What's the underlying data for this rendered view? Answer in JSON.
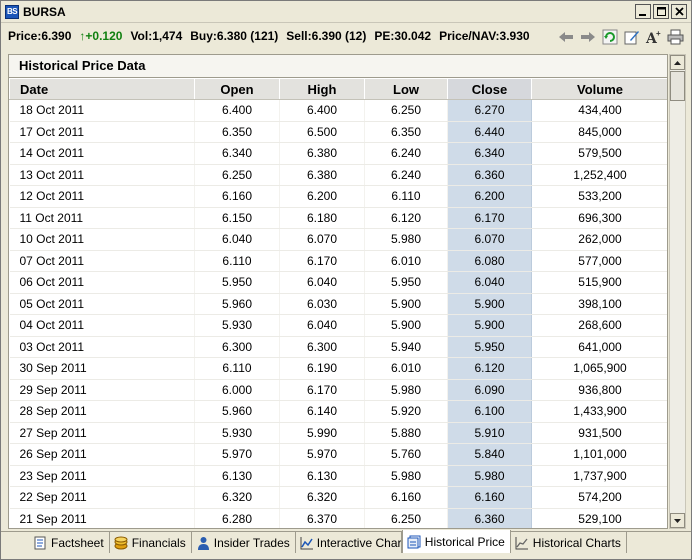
{
  "window": {
    "title": "BURSA",
    "app_icon": "BS"
  },
  "quote": {
    "price": "Price:6.390",
    "change": "+0.120",
    "vol": "Vol:1,474",
    "buy": "Buy:6.380 (121)",
    "sell": "Sell:6.390 (12)",
    "pe": "PE:30.042",
    "pnav": "Price/NAV:3.930"
  },
  "toolbar": {
    "icons": [
      "back-arrow-icon",
      "forward-arrow-icon",
      "refresh-icon",
      "edit-icon",
      "font-size-icon",
      "print-icon"
    ]
  },
  "panel": {
    "title": "Historical Price Data"
  },
  "table": {
    "headers": [
      "Date",
      "Open",
      "High",
      "Low",
      "Close",
      "Volume"
    ],
    "rows": [
      [
        "18 Oct 2011",
        "6.400",
        "6.400",
        "6.250",
        "6.270",
        "434,400"
      ],
      [
        "17 Oct 2011",
        "6.350",
        "6.500",
        "6.350",
        "6.440",
        "845,000"
      ],
      [
        "14 Oct 2011",
        "6.340",
        "6.380",
        "6.240",
        "6.340",
        "579,500"
      ],
      [
        "13 Oct 2011",
        "6.250",
        "6.380",
        "6.240",
        "6.360",
        "1,252,400"
      ],
      [
        "12 Oct 2011",
        "6.160",
        "6.200",
        "6.110",
        "6.200",
        "533,200"
      ],
      [
        "11 Oct 2011",
        "6.150",
        "6.180",
        "6.120",
        "6.170",
        "696,300"
      ],
      [
        "10 Oct 2011",
        "6.040",
        "6.070",
        "5.980",
        "6.070",
        "262,000"
      ],
      [
        "07 Oct 2011",
        "6.110",
        "6.170",
        "6.010",
        "6.080",
        "577,000"
      ],
      [
        "06 Oct 2011",
        "5.950",
        "6.040",
        "5.950",
        "6.040",
        "515,900"
      ],
      [
        "05 Oct 2011",
        "5.960",
        "6.030",
        "5.900",
        "5.900",
        "398,100"
      ],
      [
        "04 Oct 2011",
        "5.930",
        "6.040",
        "5.900",
        "5.900",
        "268,600"
      ],
      [
        "03 Oct 2011",
        "6.300",
        "6.300",
        "5.940",
        "5.950",
        "641,000"
      ],
      [
        "30 Sep 2011",
        "6.110",
        "6.190",
        "6.010",
        "6.120",
        "1,065,900"
      ],
      [
        "29 Sep 2011",
        "6.000",
        "6.170",
        "5.980",
        "6.090",
        "936,800"
      ],
      [
        "28 Sep 2011",
        "5.960",
        "6.140",
        "5.920",
        "6.100",
        "1,433,900"
      ],
      [
        "27 Sep 2011",
        "5.930",
        "5.990",
        "5.880",
        "5.910",
        "931,500"
      ],
      [
        "26 Sep 2011",
        "5.970",
        "5.970",
        "5.760",
        "5.840",
        "1,101,000"
      ],
      [
        "23 Sep 2011",
        "6.130",
        "6.130",
        "5.980",
        "5.980",
        "1,737,900"
      ],
      [
        "22 Sep 2011",
        "6.320",
        "6.320",
        "6.160",
        "6.160",
        "574,200"
      ],
      [
        "21 Sep 2011",
        "6.280",
        "6.370",
        "6.250",
        "6.360",
        "529,100"
      ]
    ]
  },
  "tabs": [
    {
      "label": "Factsheet",
      "icon": "document-icon",
      "active": false
    },
    {
      "label": "Financials",
      "icon": "coins-icon",
      "active": false
    },
    {
      "label": "Insider Trades",
      "icon": "person-icon",
      "active": false
    },
    {
      "label": "Interactive Charts",
      "icon": "line-chart-icon",
      "active": false
    },
    {
      "label": "Historical Price",
      "icon": "history-icon",
      "active": true
    },
    {
      "label": "Historical Charts",
      "icon": "chart-icon",
      "active": false
    }
  ],
  "colors": {
    "close_column": "#cfdbe8",
    "up": "#108010",
    "brand": "#1c56b8"
  }
}
